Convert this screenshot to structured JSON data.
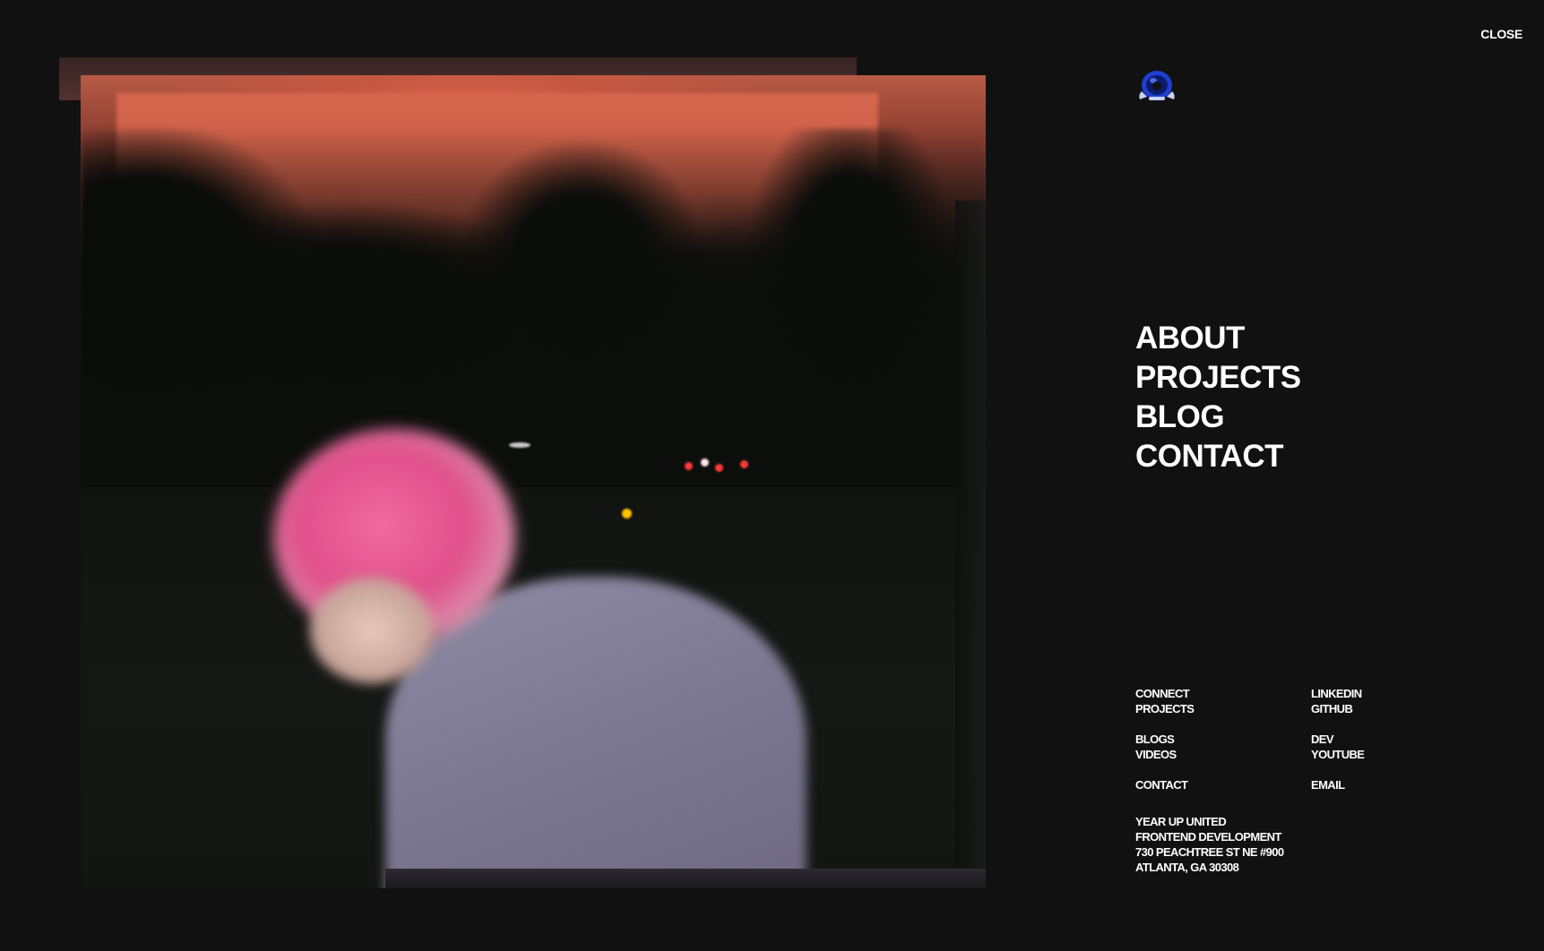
{
  "close_label": "CLOSE",
  "main_nav": {
    "about": "ABOUT",
    "projects": "PROJECTS",
    "blog": "BLOG",
    "contact": "CONTACT"
  },
  "footer": {
    "left": {
      "connect": "CONNECT",
      "projects": "PROJECTS",
      "blogs": "BLOGS",
      "videos": "VIDEOS",
      "contact": "CONTACT"
    },
    "right": {
      "linkedin": "LINKEDIN",
      "github": "GITHUB",
      "dev": "DEV",
      "youtube": "YOUTUBE",
      "email": "EMAIL"
    }
  },
  "address": {
    "line1": "YEAR UP UNITED",
    "line2": "FRONTEND DEVELOPMENT",
    "line3": "730 PEACHTREE ST NE #900",
    "line4": "ATLANTA, GA 30308"
  },
  "colors": {
    "background": "#111112",
    "text": "#ffffff",
    "logo_blue": "#2a4bd8"
  },
  "icons": {
    "logo": "astronaut-helmet-logo-icon"
  }
}
